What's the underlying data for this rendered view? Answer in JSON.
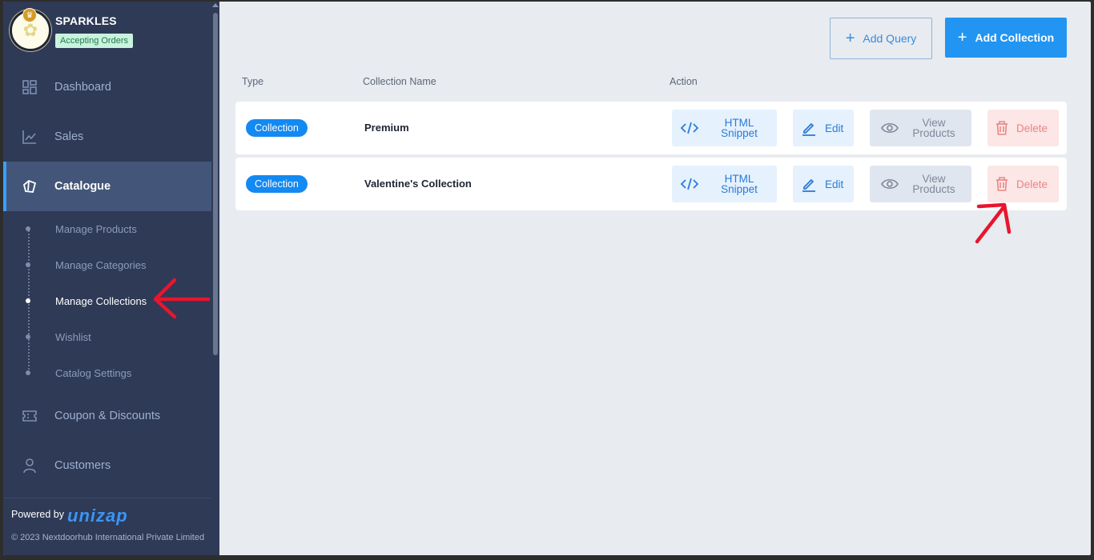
{
  "store": {
    "name": "SPARKLES",
    "status": "Accepting Orders"
  },
  "nav": {
    "dashboard": "Dashboard",
    "sales": "Sales",
    "catalogue": "Catalogue",
    "coupons": "Coupon & Discounts",
    "customers": "Customers"
  },
  "catalogue_sub": {
    "manage_products": "Manage Products",
    "manage_categories": "Manage Categories",
    "manage_collections": "Manage Collections",
    "wishlist": "Wishlist",
    "catalog_settings": "Catalog Settings"
  },
  "footer": {
    "powered_by": "Powered by",
    "brand": "unizap",
    "copyright": "© 2023 Nextdoorhub International Private Limited"
  },
  "toolbar": {
    "add_query": "Add Query",
    "add_collection": "Add Collection"
  },
  "table": {
    "headers": {
      "type": "Type",
      "name": "Collection Name",
      "action": "Action"
    },
    "rows": [
      {
        "type": "Collection",
        "name": "Premium"
      },
      {
        "type": "Collection",
        "name": "Valentine's Collection"
      }
    ],
    "actions": {
      "html_line1": "HTML",
      "html_line2": "Snippet",
      "edit": "Edit",
      "view_line1": "View",
      "view_line2": "Products",
      "delete": "Delete"
    }
  },
  "colors": {
    "accent": "#2295f2",
    "sidebar": "#2e3a56",
    "danger": "#e98585",
    "annotation": "#e8152e"
  }
}
